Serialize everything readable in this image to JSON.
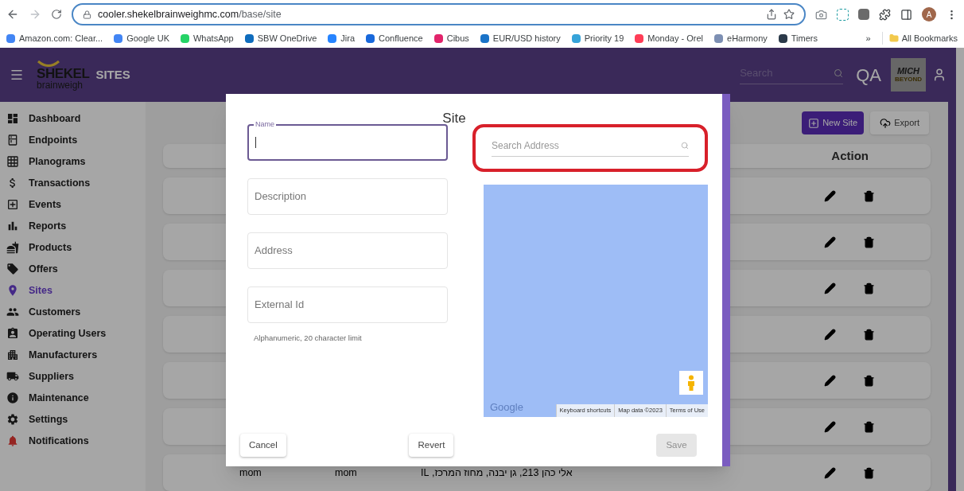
{
  "browser": {
    "url_host": "cooler.shekelbrainweighmc.com",
    "url_path": "/base/site",
    "profile_initial": "A",
    "bookmarks": [
      {
        "label": "Amazon.com: Clear...",
        "color": "#4285f4"
      },
      {
        "label": "Google UK",
        "color": "#4285f4"
      },
      {
        "label": "WhatsApp",
        "color": "#25d366"
      },
      {
        "label": "SBW OneDrive",
        "color": "#0f6cbd"
      },
      {
        "label": "Jira",
        "color": "#2684ff"
      },
      {
        "label": "Confluence",
        "color": "#1868db"
      },
      {
        "label": "Cibus",
        "color": "#e2246b"
      },
      {
        "label": "EUR/USD history",
        "color": "#1a73c8"
      },
      {
        "label": "Priority 19",
        "color": "#36a3d9"
      },
      {
        "label": "Monday - Orel",
        "color": "#ff3d57"
      },
      {
        "label": "eHarmony",
        "color": "#7d8fb3"
      },
      {
        "label": "Timers",
        "color": "#2b3a4a"
      }
    ],
    "overflow": "»",
    "all_bookmarks": "All Bookmarks"
  },
  "header": {
    "logo_top": "SHEKEL",
    "logo_bottom": "brainweigh",
    "title": "SITES",
    "search": {
      "placeholder": "Search"
    },
    "environment": "QA",
    "partner_logo": "MICH",
    "partner_tagline": "BEYOND"
  },
  "sidebar": {
    "items": [
      {
        "label": "Dashboard",
        "selected": false
      },
      {
        "label": "Endpoints",
        "selected": false
      },
      {
        "label": "Planograms",
        "selected": false
      },
      {
        "label": "Transactions",
        "selected": false
      },
      {
        "label": "Events",
        "selected": false
      },
      {
        "label": "Reports",
        "selected": false
      },
      {
        "label": "Products",
        "selected": false
      },
      {
        "label": "Offers",
        "selected": false
      },
      {
        "label": "Sites",
        "selected": true
      },
      {
        "label": "Customers",
        "selected": false
      },
      {
        "label": "Operating Users",
        "selected": false
      },
      {
        "label": "Manufacturers",
        "selected": false
      },
      {
        "label": "Suppliers",
        "selected": false
      },
      {
        "label": "Maintenance",
        "selected": false
      },
      {
        "label": "Settings",
        "selected": false
      },
      {
        "label": "Notifications",
        "selected": false
      }
    ]
  },
  "toolbar": {
    "new_button": "New Site",
    "export_button": "Export"
  },
  "table": {
    "columns": [
      "Action"
    ],
    "rows": [
      {
        "kind": "covered"
      },
      {
        "kind": "covered"
      },
      {
        "kind": "covered"
      },
      {
        "kind": "covered"
      },
      {
        "kind": "covered"
      },
      {
        "kind": "covered"
      },
      {
        "kind": "text",
        "cells": [
          "mom",
          "mom",
          "אלי כהן 213, גן יבנה, מחוז המרכז, IL"
        ]
      }
    ]
  },
  "dialog": {
    "title": "Site",
    "fields": [
      {
        "label": "Name",
        "focused": true
      },
      {
        "placeholder": "Description",
        "focused": false
      },
      {
        "placeholder": "Address",
        "focused": false
      },
      {
        "placeholder": "External Id",
        "focused": false,
        "helper": "Alphanumeric, 20 character limit"
      }
    ],
    "search_address": {
      "placeholder": "Search Address",
      "highlighted": true
    },
    "map": {
      "logo": "Google",
      "links": [
        "Keyboard shortcuts",
        "Map data ©2023",
        "Terms of Use"
      ]
    },
    "buttons": [
      {
        "label": "Cancel",
        "disabled": false
      },
      {
        "label": "Revert",
        "disabled": false
      },
      {
        "label": "Save",
        "disabled": true
      }
    ]
  }
}
